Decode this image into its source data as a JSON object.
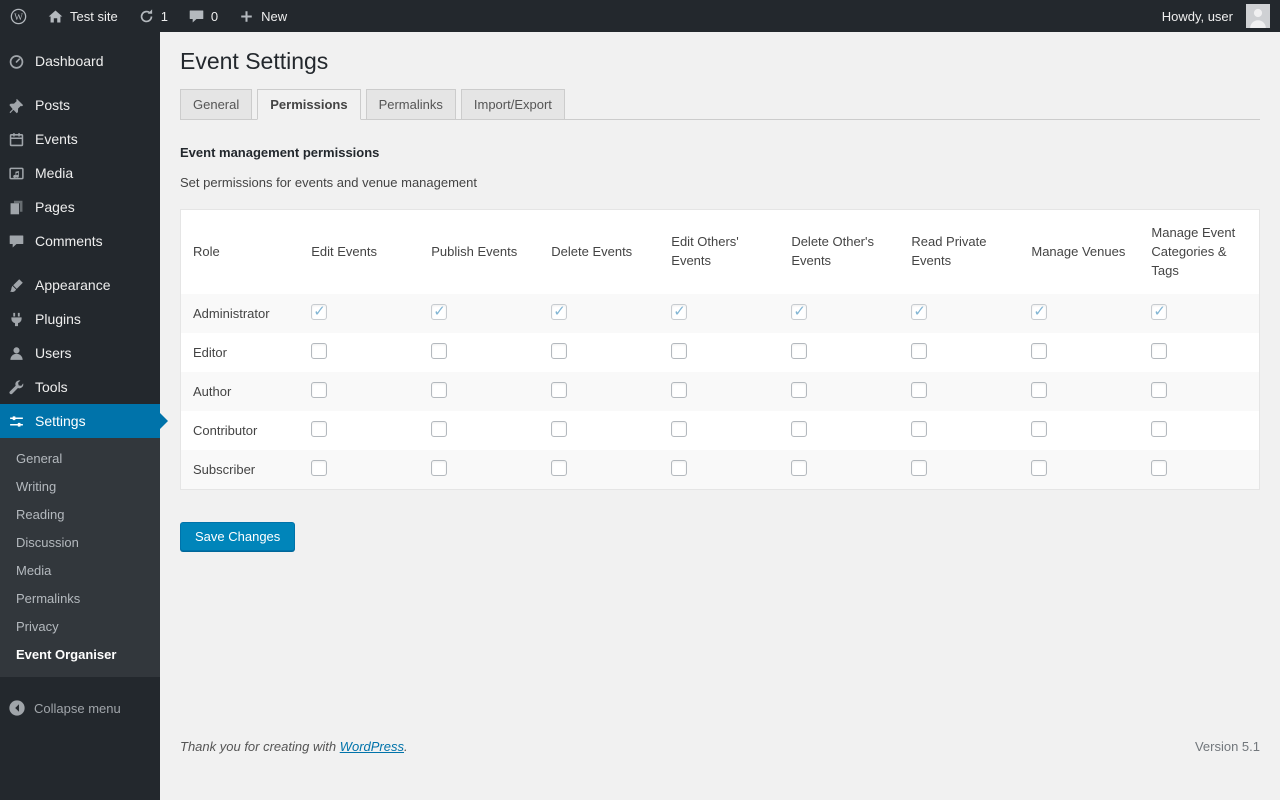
{
  "topbar": {
    "site_name": "Test site",
    "update_count": "1",
    "comment_count": "0",
    "new_label": "New",
    "howdy": "Howdy, user"
  },
  "sidebar": {
    "items": [
      {
        "label": "Dashboard",
        "icon": "dashboard"
      },
      {
        "label": "Posts",
        "icon": "pushpin",
        "separator_before": true
      },
      {
        "label": "Events",
        "icon": "calendar"
      },
      {
        "label": "Media",
        "icon": "media"
      },
      {
        "label": "Pages",
        "icon": "pages"
      },
      {
        "label": "Comments",
        "icon": "comment"
      },
      {
        "label": "Appearance",
        "icon": "appearance",
        "separator_before": true
      },
      {
        "label": "Plugins",
        "icon": "plugins"
      },
      {
        "label": "Users",
        "icon": "users"
      },
      {
        "label": "Tools",
        "icon": "tools"
      },
      {
        "label": "Settings",
        "icon": "settings",
        "active": true,
        "submenu": [
          "General",
          "Writing",
          "Reading",
          "Discussion",
          "Media",
          "Permalinks",
          "Privacy",
          "Event Organiser"
        ],
        "submenu_current": "Event Organiser"
      }
    ],
    "collapse_label": "Collapse menu"
  },
  "page": {
    "title": "Event Settings",
    "tabs": [
      {
        "label": "General"
      },
      {
        "label": "Permissions",
        "active": true
      },
      {
        "label": "Permalinks"
      },
      {
        "label": "Import/Export"
      }
    ],
    "section_heading": "Event management permissions",
    "section_desc": "Set permissions for events and venue management"
  },
  "table": {
    "columns": [
      "Role",
      "Edit Events",
      "Publish Events",
      "Delete Events",
      "Edit Others' Events",
      "Delete Other's Events",
      "Read Private Events",
      "Manage Venues",
      "Manage Event Categories & Tags"
    ],
    "rows": [
      {
        "role": "Administrator",
        "disabled": true,
        "checked": [
          true,
          true,
          true,
          true,
          true,
          true,
          true,
          true
        ]
      },
      {
        "role": "Editor",
        "checked": [
          false,
          false,
          false,
          false,
          false,
          false,
          false,
          false
        ]
      },
      {
        "role": "Author",
        "checked": [
          false,
          false,
          false,
          false,
          false,
          false,
          false,
          false
        ]
      },
      {
        "role": "Contributor",
        "checked": [
          false,
          false,
          false,
          false,
          false,
          false,
          false,
          false
        ]
      },
      {
        "role": "Subscriber",
        "checked": [
          false,
          false,
          false,
          false,
          false,
          false,
          false,
          false
        ]
      }
    ]
  },
  "actions": {
    "save_label": "Save Changes"
  },
  "footer": {
    "thanks_prefix": "Thank you for creating with ",
    "thanks_link": "WordPress",
    "thanks_suffix": ".",
    "version": "Version 5.1"
  },
  "colors": {
    "admin_bar_bg": "#23282d",
    "sidebar_bg": "#23282d",
    "submenu_bg": "#32373c",
    "active_menu": "#0073aa",
    "button_primary": "#0085ba",
    "content_bg": "#f1f1f1",
    "check_color": "#84b6d4"
  }
}
